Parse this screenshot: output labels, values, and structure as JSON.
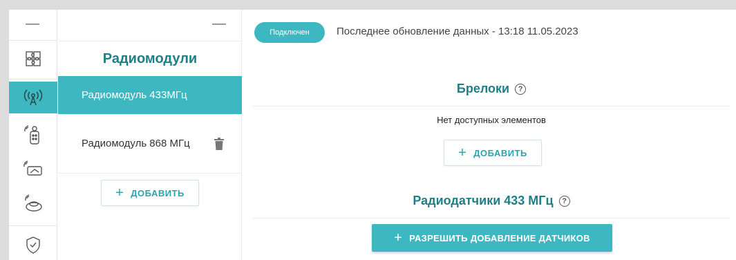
{
  "sidebar": {
    "icons": [
      {
        "name": "puzzle-icon",
        "active": false
      },
      {
        "name": "radio-antenna-icon",
        "active": true
      },
      {
        "name": "remote-fob-icon",
        "active": false
      },
      {
        "name": "wireless-gauge-icon",
        "active": false
      },
      {
        "name": "wireless-siren-icon",
        "active": false
      },
      {
        "name": "shield-check-icon",
        "active": false
      }
    ],
    "accent_color": "#3db8c1"
  },
  "modules_panel": {
    "title": "Радиомодули",
    "items": [
      {
        "label": "Радиомодуль 433МГц",
        "active": true
      },
      {
        "label": "Радиомодуль 868 МГц",
        "active": false
      }
    ],
    "add_label": "ДОБАВИТЬ"
  },
  "header": {
    "status_badge": "Подключен",
    "last_update": "Последнее обновление данных - 13:18 11.05.2023"
  },
  "fobs_section": {
    "title": "Брелоки",
    "empty_text": "Нет доступных элементов",
    "add_label": "ДОБАВИТЬ"
  },
  "sensors_section": {
    "title": "Радиодатчики 433 МГц",
    "allow_label": "РАЗРЕШИТЬ ДОБАВЛЕНИЕ ДАТЧИКОВ"
  }
}
